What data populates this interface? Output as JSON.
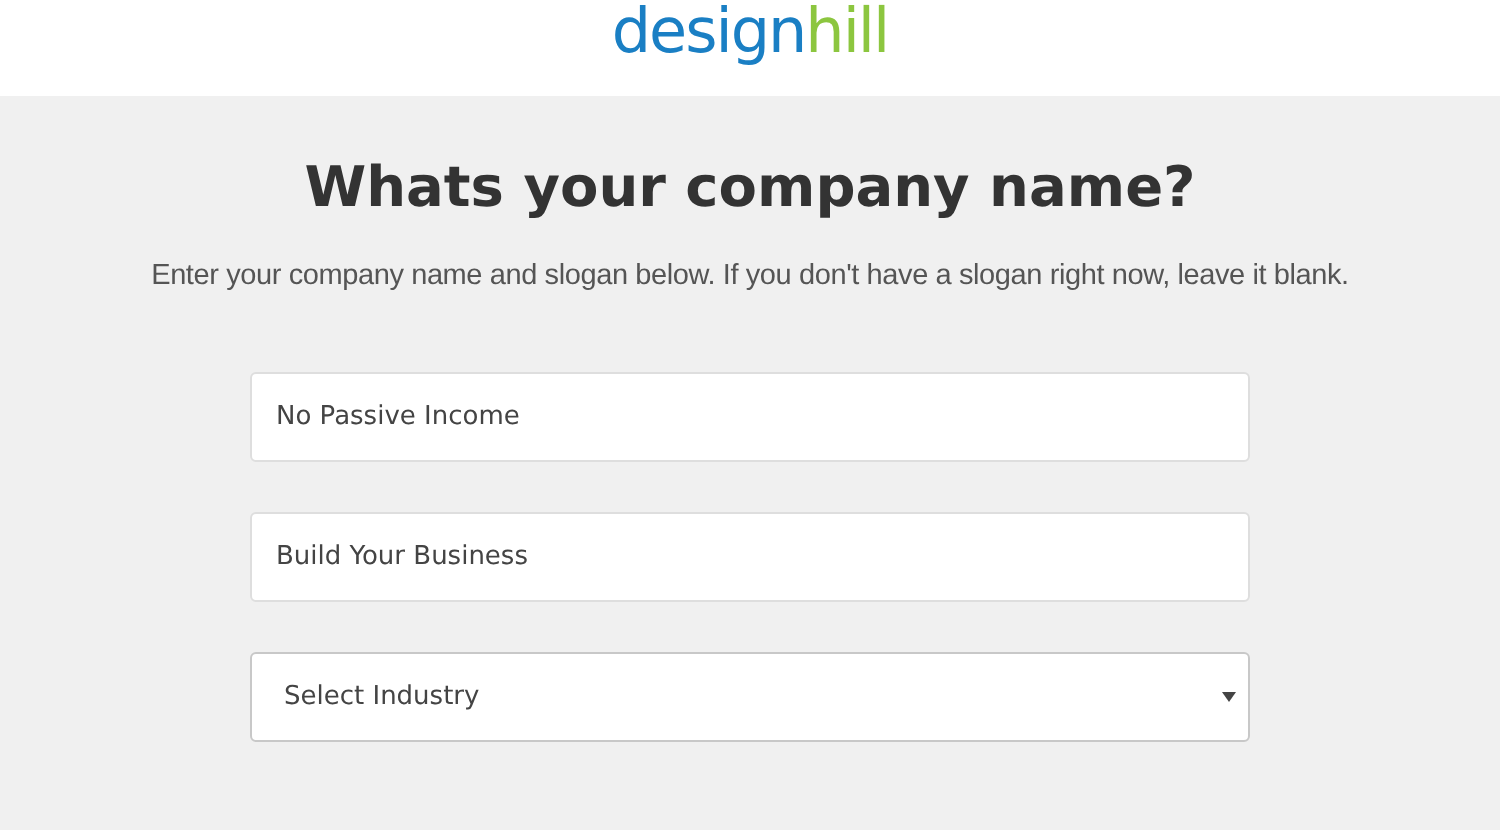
{
  "header": {
    "logo": [
      {
        "text": "design",
        "color": "#1a7fc4"
      },
      {
        "text": "hill",
        "color": "#8cc63f"
      }
    ]
  },
  "title": "Whats your company name?",
  "subtitle": "Enter your company name and slogan below. If you don't have a slogan right now, leave it blank.",
  "fields": [
    {
      "kind": "text",
      "value": "No Passive Income"
    },
    {
      "kind": "text",
      "value": "Build Your Business"
    },
    {
      "kind": "select",
      "value": "Select Industry"
    }
  ]
}
